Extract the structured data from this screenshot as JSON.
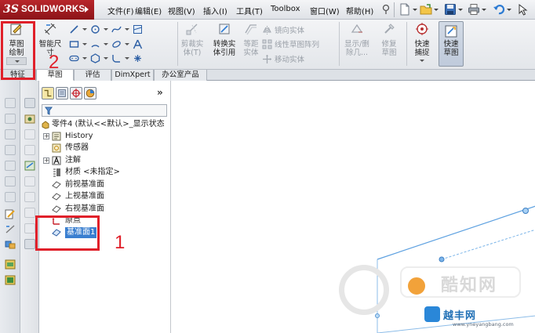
{
  "app": {
    "brand": "SOLIDWORKS",
    "ds_mark": "3S"
  },
  "menu": [
    "文件(F)",
    "编辑(E)",
    "视图(V)",
    "插入(I)",
    "工具(T)",
    "Toolbox",
    "窗口(W)",
    "帮助(H)"
  ],
  "command_manager": {
    "sketch_button": "草图绘制",
    "smart_dimension": "智能尺寸",
    "trim_entities": "剪裁实体(T)",
    "convert_entities": "转换实体引用",
    "offset_entities": "等距实体",
    "mirror_entities": "镜向实体",
    "linear_pattern": "线性草图阵列",
    "move_entities": "移动实体",
    "display_delete_relations": "显示/删除几...",
    "repair_sketch": "修复草图",
    "quick_snaps": "快速捕捉",
    "rapid_sketch": "快速草图",
    "features_tab_label": "特征"
  },
  "tabs": [
    "草图",
    "评估",
    "DimXpert",
    "办公室产品"
  ],
  "feature_tree": {
    "root": "零件4 (默认<<默认>_显示状态",
    "items": [
      "History",
      "传感器",
      "注解",
      "材质 <未指定>",
      "前视基准面",
      "上视基准面",
      "右视基准面",
      "原点",
      "基准面1"
    ]
  },
  "annotations": {
    "box_feature_number": "2",
    "box_plane_number": "1",
    "accent": "#e0202a"
  },
  "watermark": {
    "main": "酷知网",
    "brand": "越丰网",
    "url": "www.yneyangbang.com"
  }
}
